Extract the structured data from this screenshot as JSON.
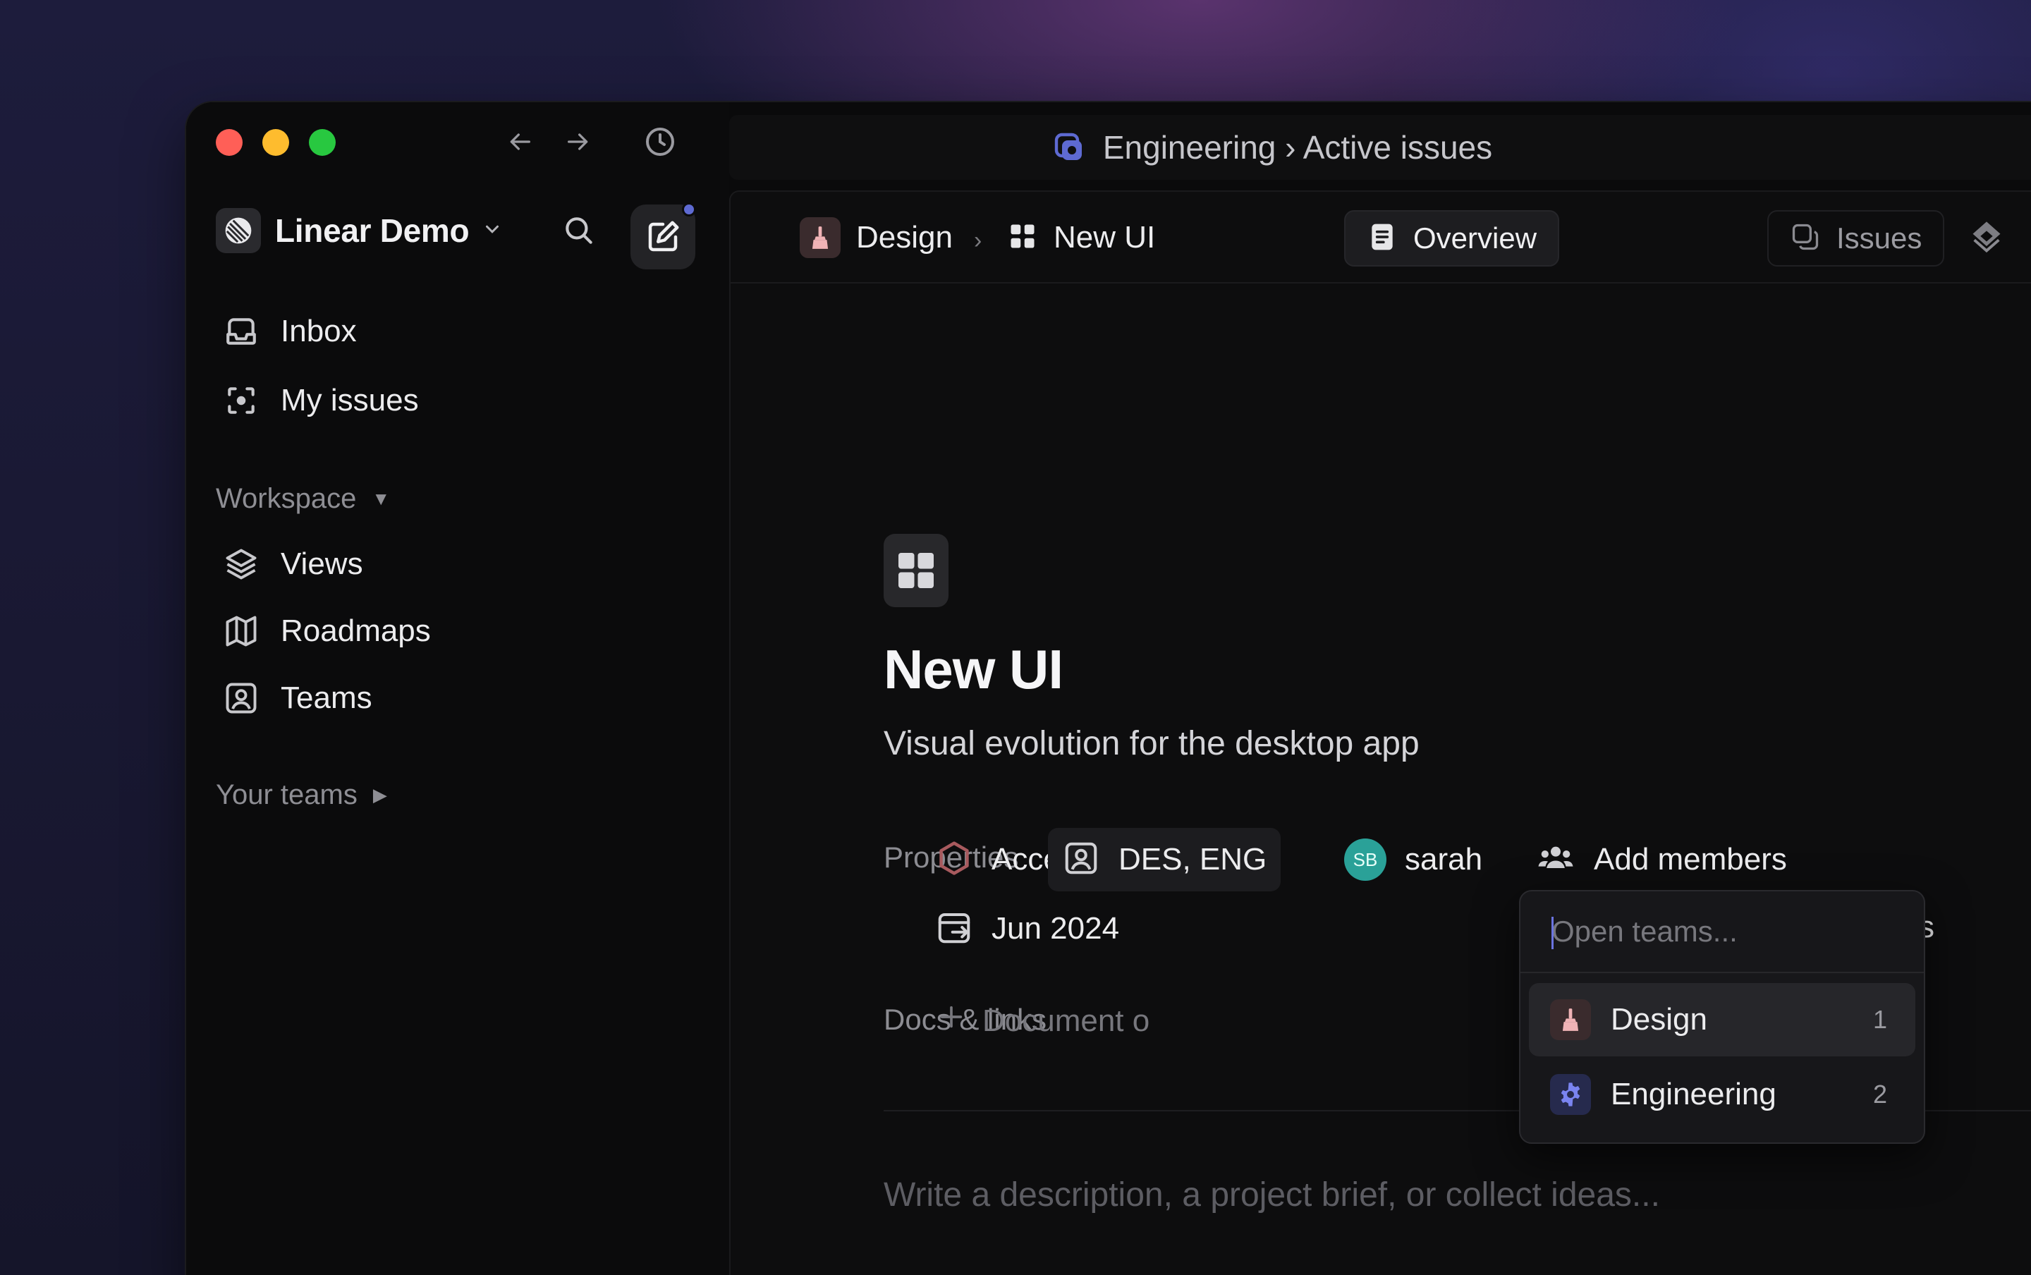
{
  "titlebar": {
    "title": "Engineering › Active issues"
  },
  "sidebar": {
    "workspace_name": "Linear Demo",
    "items": [
      {
        "label": "Inbox",
        "icon": "inbox-icon"
      },
      {
        "label": "My issues",
        "icon": "my-issues-icon"
      }
    ],
    "workspace_section": "Workspace",
    "workspace_items": [
      {
        "label": "Views",
        "icon": "layers-icon"
      },
      {
        "label": "Roadmaps",
        "icon": "map-icon"
      },
      {
        "label": "Teams",
        "icon": "team-icon"
      }
    ],
    "your_teams": "Your teams"
  },
  "header": {
    "crumb_team": "Design",
    "crumb_project": "New UI",
    "more": "•••",
    "tabs": [
      {
        "label": "Overview",
        "active": true
      },
      {
        "label": "Issues",
        "active": false
      }
    ]
  },
  "project": {
    "title": "New UI",
    "subtitle": "Visual evolution for the desktop app",
    "properties_label": "Properties",
    "status": "Accepted",
    "teams": "DES, ENG",
    "lead_initials": "SB",
    "lead": "sarah",
    "add_members": "Add members",
    "target_date": "Jun 2024",
    "docs_label": "Docs & links",
    "docs_add": "Document o",
    "desc_placeholder": "Write a description, a project brief, or collect ideas...",
    "hidden_suffix": "s"
  },
  "dropdown": {
    "placeholder": "Open teams...",
    "options": [
      {
        "label": "Design",
        "count": "1",
        "selected": true
      },
      {
        "label": "Engineering",
        "count": "2",
        "selected": false
      }
    ]
  },
  "colors": {
    "accent": "#5e6ad2",
    "avatar": "#2aa198",
    "traffic_red": "#ff5f57",
    "traffic_yellow": "#febc2e",
    "traffic_green": "#28c840"
  }
}
